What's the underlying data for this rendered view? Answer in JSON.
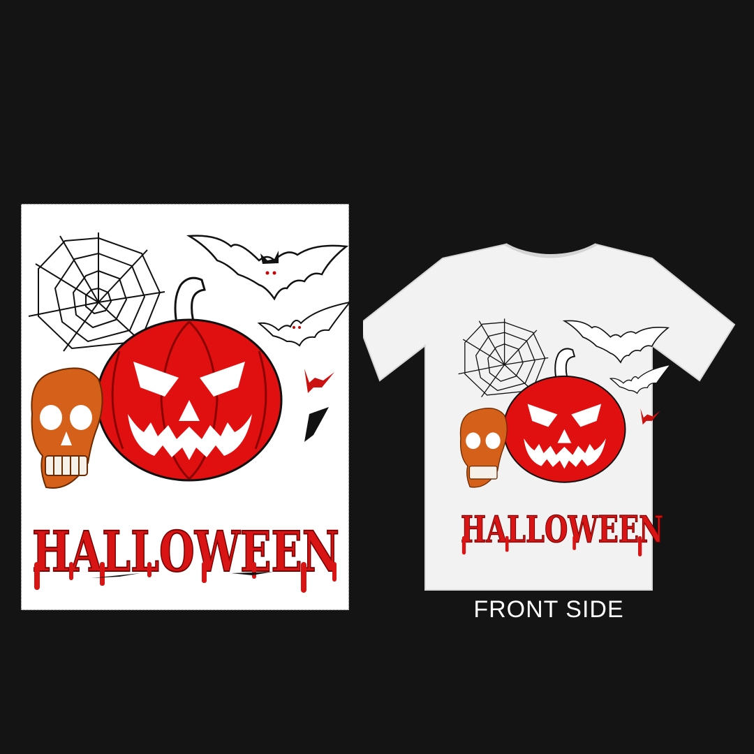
{
  "design": {
    "wordmark": "HALLOWEEN",
    "colors": {
      "background": "#141414",
      "print_area": "#ffffff",
      "shirt": "#f2f2f2",
      "pumpkin": "#e01010",
      "pumpkin_dark": "#8a0000",
      "skull": "#d4601a",
      "ink": "#111111"
    }
  },
  "mockup": {
    "caption": "FRONT SIDE"
  }
}
